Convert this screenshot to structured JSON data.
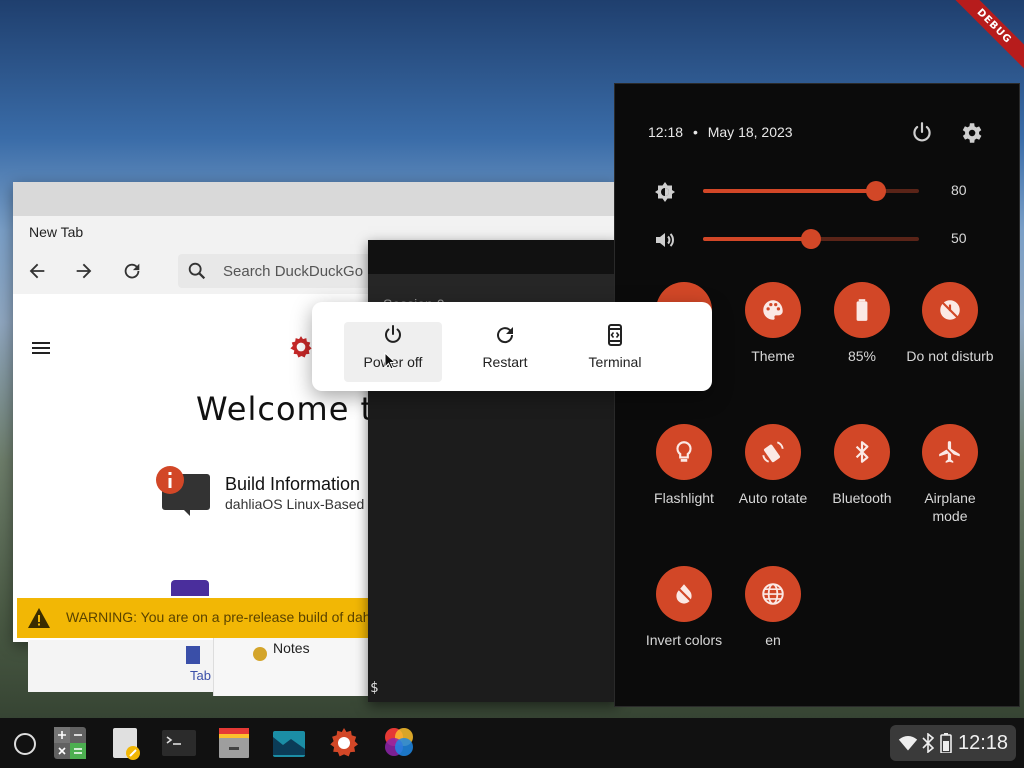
{
  "debug_banner": "DEBUG",
  "browser": {
    "tab_title": "New Tab",
    "search_placeholder": "Search DuckDuckGo",
    "welcome": "Welcome t",
    "build_title": "Build Information",
    "build_subtitle": "dahliaOS Linux-Based",
    "warning": "WARNING: You are on a pre-release build of dahl",
    "tab_label": "Tab",
    "notes_label": "Notes"
  },
  "terminal": {
    "tab_label": "Session 0",
    "prompt": "$"
  },
  "quick_settings": {
    "time": "12:18",
    "separator": "•",
    "date": "May 18, 2023",
    "brightness": {
      "value": 80,
      "label": "80",
      "icon": "brightness-icon"
    },
    "volume": {
      "value": 50,
      "label": "50",
      "icon": "volume-icon"
    },
    "tiles": [
      {
        "label": "Theme",
        "icon": "palette-icon"
      },
      {
        "label": "85%",
        "icon": "battery-icon"
      },
      {
        "label": "Do not disturb",
        "icon": "do-not-disturb-icon"
      },
      {
        "label": "Flashlight",
        "icon": "flashlight-icon"
      },
      {
        "label": "Auto rotate",
        "icon": "auto-rotate-icon"
      },
      {
        "label": "Bluetooth",
        "icon": "bluetooth-icon"
      },
      {
        "label": "Airplane mode",
        "icon": "airplane-icon"
      },
      {
        "label": "Invert colors",
        "icon": "invert-colors-icon"
      },
      {
        "label": "en",
        "icon": "language-icon"
      }
    ],
    "accent_color": "#d24727"
  },
  "power_dialog": {
    "poweroff": "Power off",
    "restart": "Restart",
    "terminal": "Terminal"
  },
  "taskbar": {
    "time": "12:18",
    "apps": [
      "calculator",
      "notes",
      "terminal",
      "files",
      "image-viewer",
      "settings",
      "web-browser"
    ]
  }
}
